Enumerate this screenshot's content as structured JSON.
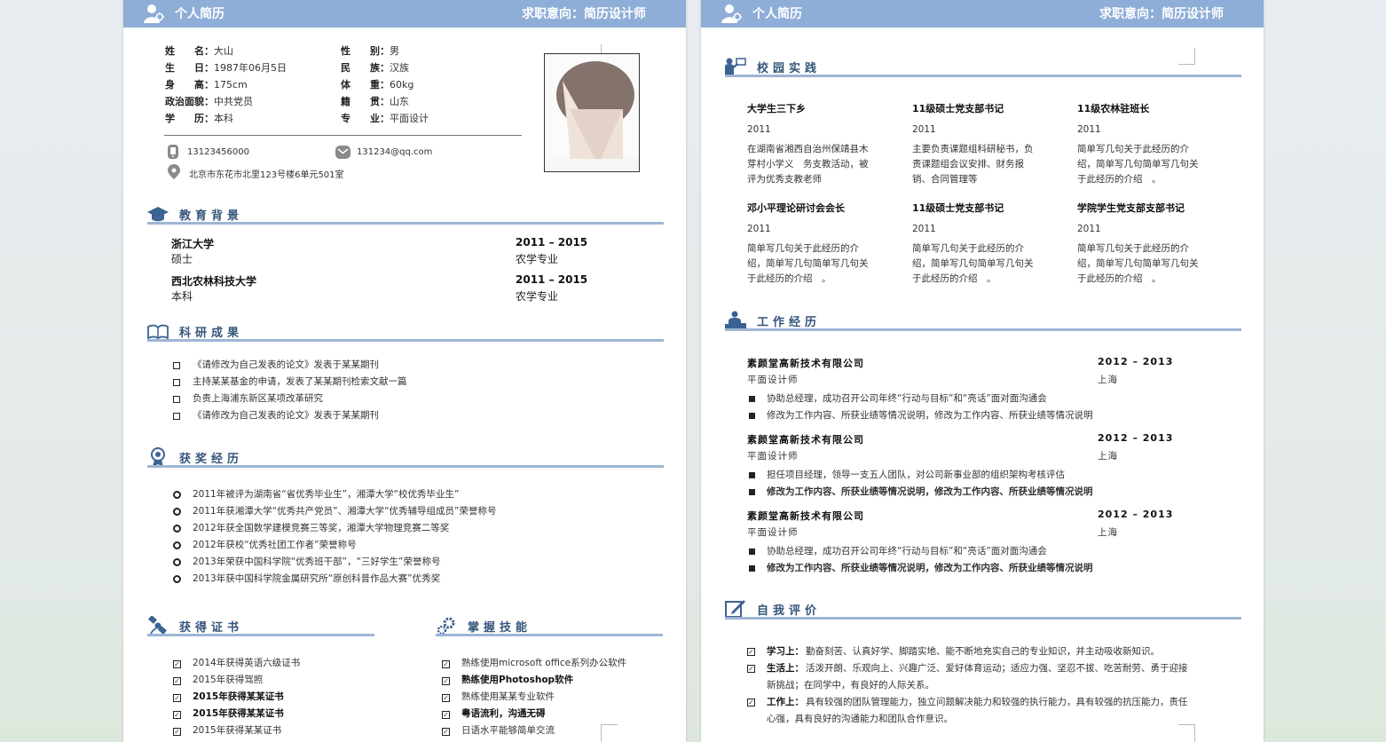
{
  "header": {
    "left": "个人简历",
    "right": "求职意向：简历设计师"
  },
  "basic_info": {
    "left": [
      {
        "label": "姓　　名：",
        "value": "大山"
      },
      {
        "label": "生　　日：",
        "value": "1987年06月5日"
      },
      {
        "label": "身　　高：",
        "value": "175cm"
      },
      {
        "label": "政治面貌：",
        "value": "中共党员"
      },
      {
        "label": "学　　历：",
        "value": "本科"
      }
    ],
    "right": [
      {
        "label": "性　　别：",
        "value": "男"
      },
      {
        "label": "民　　族：",
        "value": "汉族"
      },
      {
        "label": "体　　重：",
        "value": "60kg"
      },
      {
        "label": "籍　　贯：",
        "value": "山东"
      },
      {
        "label": "专　　业：",
        "value": "平面设计"
      }
    ]
  },
  "contact": {
    "phone": "13123456000",
    "email": "131234@qq.com",
    "address": "北京市东花市北里123号楼6单元501室"
  },
  "education": {
    "title": "教育背景",
    "items": [
      {
        "school": "浙江大学",
        "degree": "硕士",
        "years": "2011 – 2015",
        "major": "农学专业"
      },
      {
        "school": "西北农林科技大学",
        "degree": "本科",
        "years": "2011 – 2015",
        "major": "农学专业"
      }
    ]
  },
  "research": {
    "title": "科研成果",
    "items": [
      "《请修改为自己发表的论文》发表于某某期刊",
      "主持某某基金的申请，发表了某某期刊检索文献一篇",
      "负责上海浦东新区某项改革研究",
      "《请修改为自己发表的论文》发表于某某期刊"
    ]
  },
  "awards": {
    "title": "获奖经历",
    "items": [
      "2011年被评为湖南省“省优秀毕业生”，湘潭大学“校优秀毕业生”",
      "2011年获湘潭大学“优秀共产党员”、湘潭大学“优秀辅导组成员”荣誉称号",
      "2012年获全国数学建模竞赛三等奖，湘潭大学物理竞赛二等奖",
      "2012年获校“优秀社团工作者”荣誉称号",
      "2013年荣获中国科学院“优秀班干部”，“三好学生”荣誉称号",
      "2013年获中国科学院金属研究所“原创科普作品大赛”优秀奖"
    ]
  },
  "certificates": {
    "title": "获得证书",
    "items": [
      {
        "text": "2014年获得英语六级证书",
        "bold": false
      },
      {
        "text": "2015年获得驾照",
        "bold": false
      },
      {
        "text": "2015年获得某某证书",
        "bold": true
      },
      {
        "text": "2015年获得某某证书",
        "bold": true
      },
      {
        "text": "2015年获得某某证书",
        "bold": false
      }
    ]
  },
  "skills": {
    "title": "掌握技能",
    "items": [
      {
        "text": "熟练使用microsoft office系列办公软件",
        "bold": false
      },
      {
        "text": "熟练使用Photoshop软件",
        "bold": true
      },
      {
        "text": "熟练使用某某专业软件",
        "bold": false
      },
      {
        "text": "粤语流利，沟通无碍",
        "bold": true
      },
      {
        "text": "日语水平能够简单交流",
        "bold": false
      }
    ]
  },
  "campus": {
    "title": "校园实践",
    "items": [
      {
        "title": "大学生三下乡",
        "year": "2011",
        "desc": "在湖南省湘西自治州保靖县木芽村小学义　务支教活动，被评为优秀支教老师"
      },
      {
        "title": "11级硕士党支部书记",
        "year": "2011",
        "desc": "主要负责课题组科研秘书，负责课题组会议安排、财务报销、合同管理等"
      },
      {
        "title": "11级农林驻班长",
        "year": "2011",
        "desc": "简单写几句关于此经历的介绍，简单写几句简单写几句关于此经历的介绍　。"
      },
      {
        "title": "邓小平理论研讨会会长",
        "year": "2011",
        "desc": "简单写几句关于此经历的介绍，简单写几句简单写几句关于此经历的介绍　。"
      },
      {
        "title": "11级硕士党支部书记",
        "year": "2011",
        "desc": "简单写几句关于此经历的介绍，简单写几句简单写几句关于此经历的介绍　。"
      },
      {
        "title": "学院学生党支部支部书记",
        "year": "2011",
        "desc": "简单写几句关于此经历的介绍，简单写几句简单写几句关于此经历的介绍　。"
      }
    ]
  },
  "work": {
    "title": "工作经历",
    "items": [
      {
        "company": "素颜堂高新技术有限公司",
        "years": "2012 – 2013",
        "role": "平面设计师",
        "city": "上海",
        "bullets": [
          {
            "text": "协助总经理，成功召开公司年终“行动与目标”和“亮话”面对面沟通会",
            "bold": false
          },
          {
            "text": "修改为工作内容、所获业绩等情况说明，修改为工作内容、所获业绩等情况说明",
            "bold": false
          }
        ]
      },
      {
        "company": "素颜堂高新技术有限公司",
        "years": "2012 – 2013",
        "role": "平面设计师",
        "city": "上海",
        "bullets": [
          {
            "text": "担任项目经理，领导一支五人团队，对公司新事业部的组织架构考核评估",
            "bold": false
          },
          {
            "text": "修改为工作内容、所获业绩等情况说明，修改为工作内容、所获业绩等情况说明",
            "bold": true
          }
        ]
      },
      {
        "company": "素颜堂高新技术有限公司",
        "years": "2012 – 2013",
        "role": "平面设计师",
        "city": "上海",
        "bullets": [
          {
            "text": "协助总经理，成功召开公司年终“行动与目标”和“亮话”面对面沟通会",
            "bold": false
          },
          {
            "text": "修改为工作内容、所获业绩等情况说明，修改为工作内容、所获业绩等情况说明",
            "bold": true
          }
        ]
      }
    ]
  },
  "self_eval": {
    "title": "自我评价",
    "items": [
      {
        "label": "学习上：",
        "lines": [
          "勤奋刻苦、认真好学、脚踏实地、能不断地充实自己的专业知识，并主动吸收新知识。"
        ]
      },
      {
        "label": "生活上：",
        "lines": [
          "活泼开朗、乐观向上、兴趣广泛、爱好体育运动；适应力强、坚忍不拔、吃苦耐劳、勇于迎接",
          "新挑战；在同学中，有良好的人际关系。"
        ]
      },
      {
        "label": "工作上：",
        "lines": [
          "具有较强的团队管理能力，独立问题解决能力和较强的执行能力，具有较强的抗压能力，责任",
          "心强，具有良好的沟通能力和团队合作意识。"
        ]
      }
    ]
  }
}
